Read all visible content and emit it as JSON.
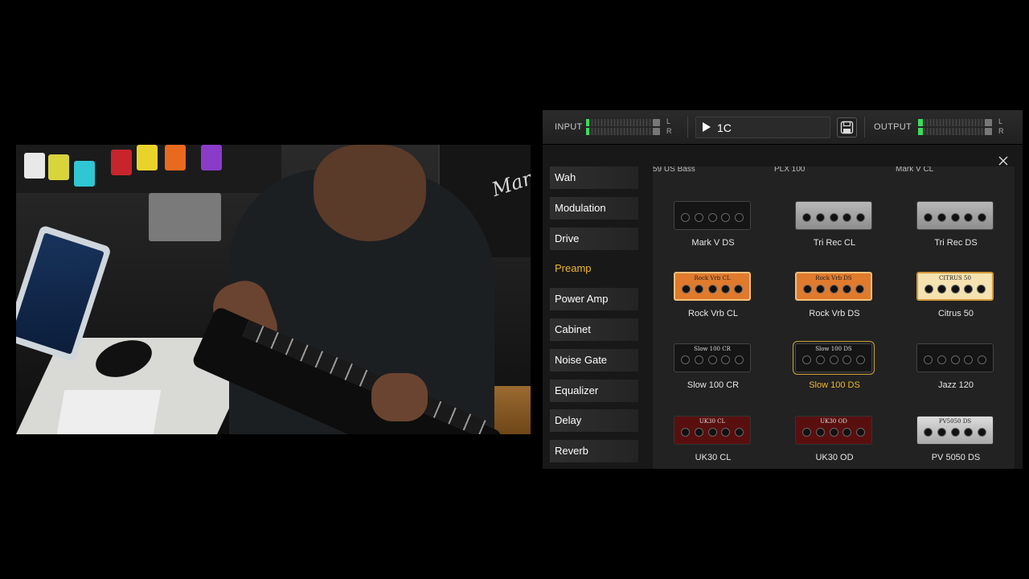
{
  "video": {
    "amp_brand": "Marshall"
  },
  "topbar": {
    "input_label": "INPUT",
    "output_label": "OUTPUT",
    "channel_left": "L",
    "channel_right": "R",
    "input_level": 0.04,
    "output_level": 0.06,
    "preset_name": "1C"
  },
  "sidebar": {
    "items": [
      {
        "label": "Wah",
        "active": false
      },
      {
        "label": "Modulation",
        "active": false
      },
      {
        "label": "Drive",
        "active": false
      },
      {
        "label": "Preamp",
        "active": true
      },
      {
        "label": "Power Amp",
        "active": false
      },
      {
        "label": "Cabinet",
        "active": false
      },
      {
        "label": "Noise Gate",
        "active": false
      },
      {
        "label": "Equalizer",
        "active": false
      },
      {
        "label": "Delay",
        "active": false
      },
      {
        "label": "Reverb",
        "active": false
      }
    ]
  },
  "grid": {
    "partial_row": [
      "59 US Bass",
      "PLX 100",
      "Mark V CL"
    ],
    "tiles": [
      {
        "label": "Mark V DS",
        "style": "black",
        "tag": "",
        "selected": false
      },
      {
        "label": "Tri Rec CL",
        "style": "silver",
        "tag": "",
        "selected": false
      },
      {
        "label": "Tri Rec DS",
        "style": "silver",
        "tag": "",
        "selected": false
      },
      {
        "label": "Rock Vrb CL",
        "style": "orange",
        "tag": "Rock Vrb CL",
        "selected": false
      },
      {
        "label": "Rock Vrb DS",
        "style": "orange",
        "tag": "Rock Vrb DS",
        "selected": false
      },
      {
        "label": "Citrus 50",
        "style": "cream",
        "tag": "CITRUS 50",
        "selected": false
      },
      {
        "label": "Slow 100 CR",
        "style": "black",
        "tag": "Slow 100 CR",
        "selected": false
      },
      {
        "label": "Slow 100 DS",
        "style": "black",
        "tag": "Slow 100 DS",
        "selected": true
      },
      {
        "label": "Jazz 120",
        "style": "black",
        "tag": "",
        "selected": false
      },
      {
        "label": "UK30 CL",
        "style": "red",
        "tag": "UK30 CL",
        "selected": false
      },
      {
        "label": "UK30 OD",
        "style": "red",
        "tag": "UK30 OD",
        "selected": false
      },
      {
        "label": "PV 5050 DS",
        "style": "grey",
        "tag": "PV5050 DS",
        "selected": false
      }
    ]
  },
  "colors": {
    "accent": "#f0b730",
    "meter_green": "#3ddc5c",
    "panel_bg": "#181818"
  },
  "icons": {
    "close": "close-icon",
    "save": "save-icon",
    "play": "play-icon"
  }
}
